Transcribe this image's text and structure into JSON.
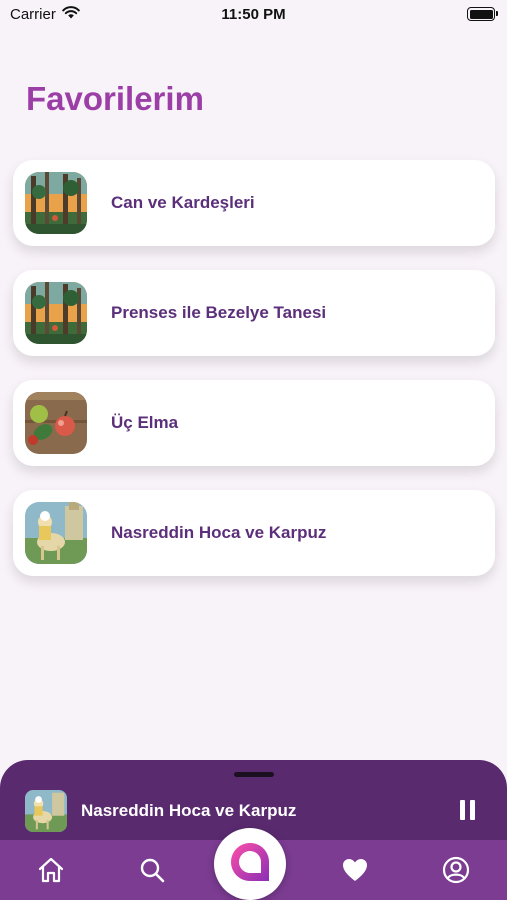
{
  "status_bar": {
    "carrier": "Carrier",
    "time": "11:50 PM",
    "battery_level": 1.0
  },
  "page": {
    "title": "Favorilerim"
  },
  "favorites": [
    {
      "title": "Can ve Kardeşleri",
      "thumb_icon": "forest-thumbnail"
    },
    {
      "title": "Prenses ile Bezelye Tanesi",
      "thumb_icon": "forest-thumbnail"
    },
    {
      "title": "Üç Elma",
      "thumb_icon": "apples-thumbnail"
    },
    {
      "title": "Nasreddin Hoca ve Karpuz",
      "thumb_icon": "donkey-thumbnail"
    }
  ],
  "player": {
    "title": "Nasreddin Hoca ve Karpuz",
    "state": "playing",
    "control_icon": "pause-icon"
  },
  "tab_bar": {
    "items": [
      "home-icon",
      "search-icon",
      "app-logo-icon",
      "heart-icon",
      "profile-icon"
    ]
  },
  "colors": {
    "accent": "#9b3fa7",
    "item_text": "#5c2f7a",
    "player_bg": "#5a2a6f",
    "tab_bg": "#7b3c92",
    "page_bg": "#f8f3f9"
  }
}
